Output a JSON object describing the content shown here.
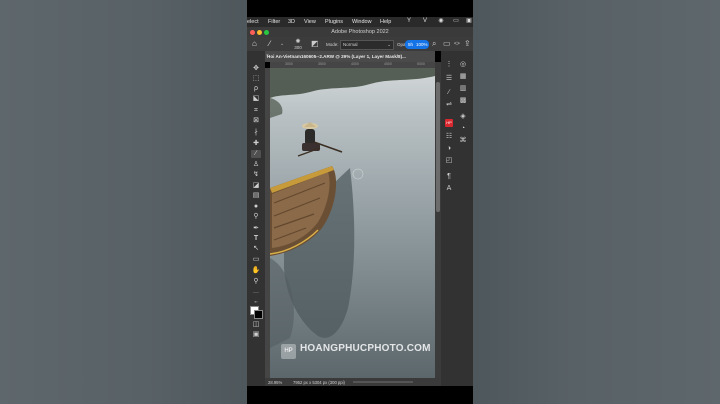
{
  "menubar": {
    "items": [
      "elect",
      "Filter",
      "3D",
      "View",
      "Plugins",
      "Window",
      "Help"
    ],
    "status_icons": [
      "yi-icon",
      "v-icon",
      "eye-icon",
      "battery-icon",
      "display-icon"
    ]
  },
  "titlebar": {
    "title": "Adobe Photoshop 2022"
  },
  "options": {
    "brush_size": "300",
    "mode_label": "Mode:",
    "mode_value": "Normal",
    "opacity_label": "Opac",
    "opacity_value": "100%",
    "overlay_badge": "5h"
  },
  "document": {
    "tab_title": "Hoi An-Vietnam160605--2.ARW @ 29% (Layer 1, Layer Mask/8)...",
    "ruler_ticks": [
      "3000",
      "3500",
      "4000",
      "4500",
      "5000"
    ]
  },
  "status": {
    "zoom": "28.95%",
    "dimensions": "7952 px x 5304 px (300 ppi)"
  },
  "watermark": {
    "logo_text": "HP",
    "text": "HOANGPHUCPHOTO.COM"
  },
  "colors": {
    "ui_dark": "#323232",
    "panel_red": "#d9282f",
    "accent_blue": "#1473e6"
  }
}
